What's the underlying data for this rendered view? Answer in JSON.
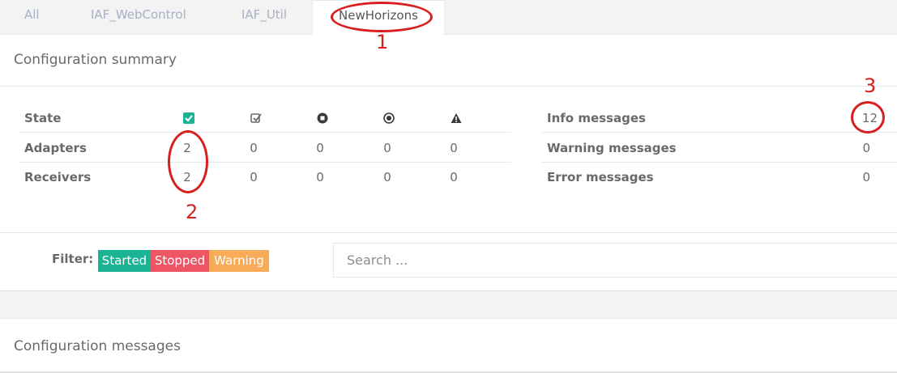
{
  "tabs": [
    {
      "label": "All"
    },
    {
      "label": "IAF_WebControl"
    },
    {
      "label": "IAF_Util"
    },
    {
      "label": "NewHorizons"
    }
  ],
  "summary": {
    "title": "Configuration summary",
    "state_label": "State",
    "state_icons": [
      "started-icon",
      "warning-check-icon",
      "stopped-icon",
      "error-icon",
      "warning-icon"
    ],
    "rows": [
      {
        "label": "Adapters",
        "values": [
          "2",
          "0",
          "0",
          "0",
          "0"
        ]
      },
      {
        "label": "Receivers",
        "values": [
          "2",
          "0",
          "0",
          "0",
          "0"
        ]
      }
    ],
    "messages": [
      {
        "label": "Info messages",
        "value": "12"
      },
      {
        "label": "Warning messages",
        "value": "0"
      },
      {
        "label": "Error messages",
        "value": "0"
      }
    ]
  },
  "filter": {
    "label": "Filter:",
    "buttons": [
      {
        "label": "Started",
        "color": "#1ab394"
      },
      {
        "label": "Stopped",
        "color": "#ed5565"
      },
      {
        "label": "Warning",
        "color": "#f8ac59"
      }
    ],
    "search_placeholder": "Search ..."
  },
  "messages_panel": {
    "title": "Configuration messages"
  },
  "annotations": [
    "1",
    "2",
    "3"
  ],
  "colors": {
    "accent_red": "#d71f1f",
    "started": "#1ab394",
    "stopped": "#ed5565",
    "warning": "#f8ac59"
  }
}
